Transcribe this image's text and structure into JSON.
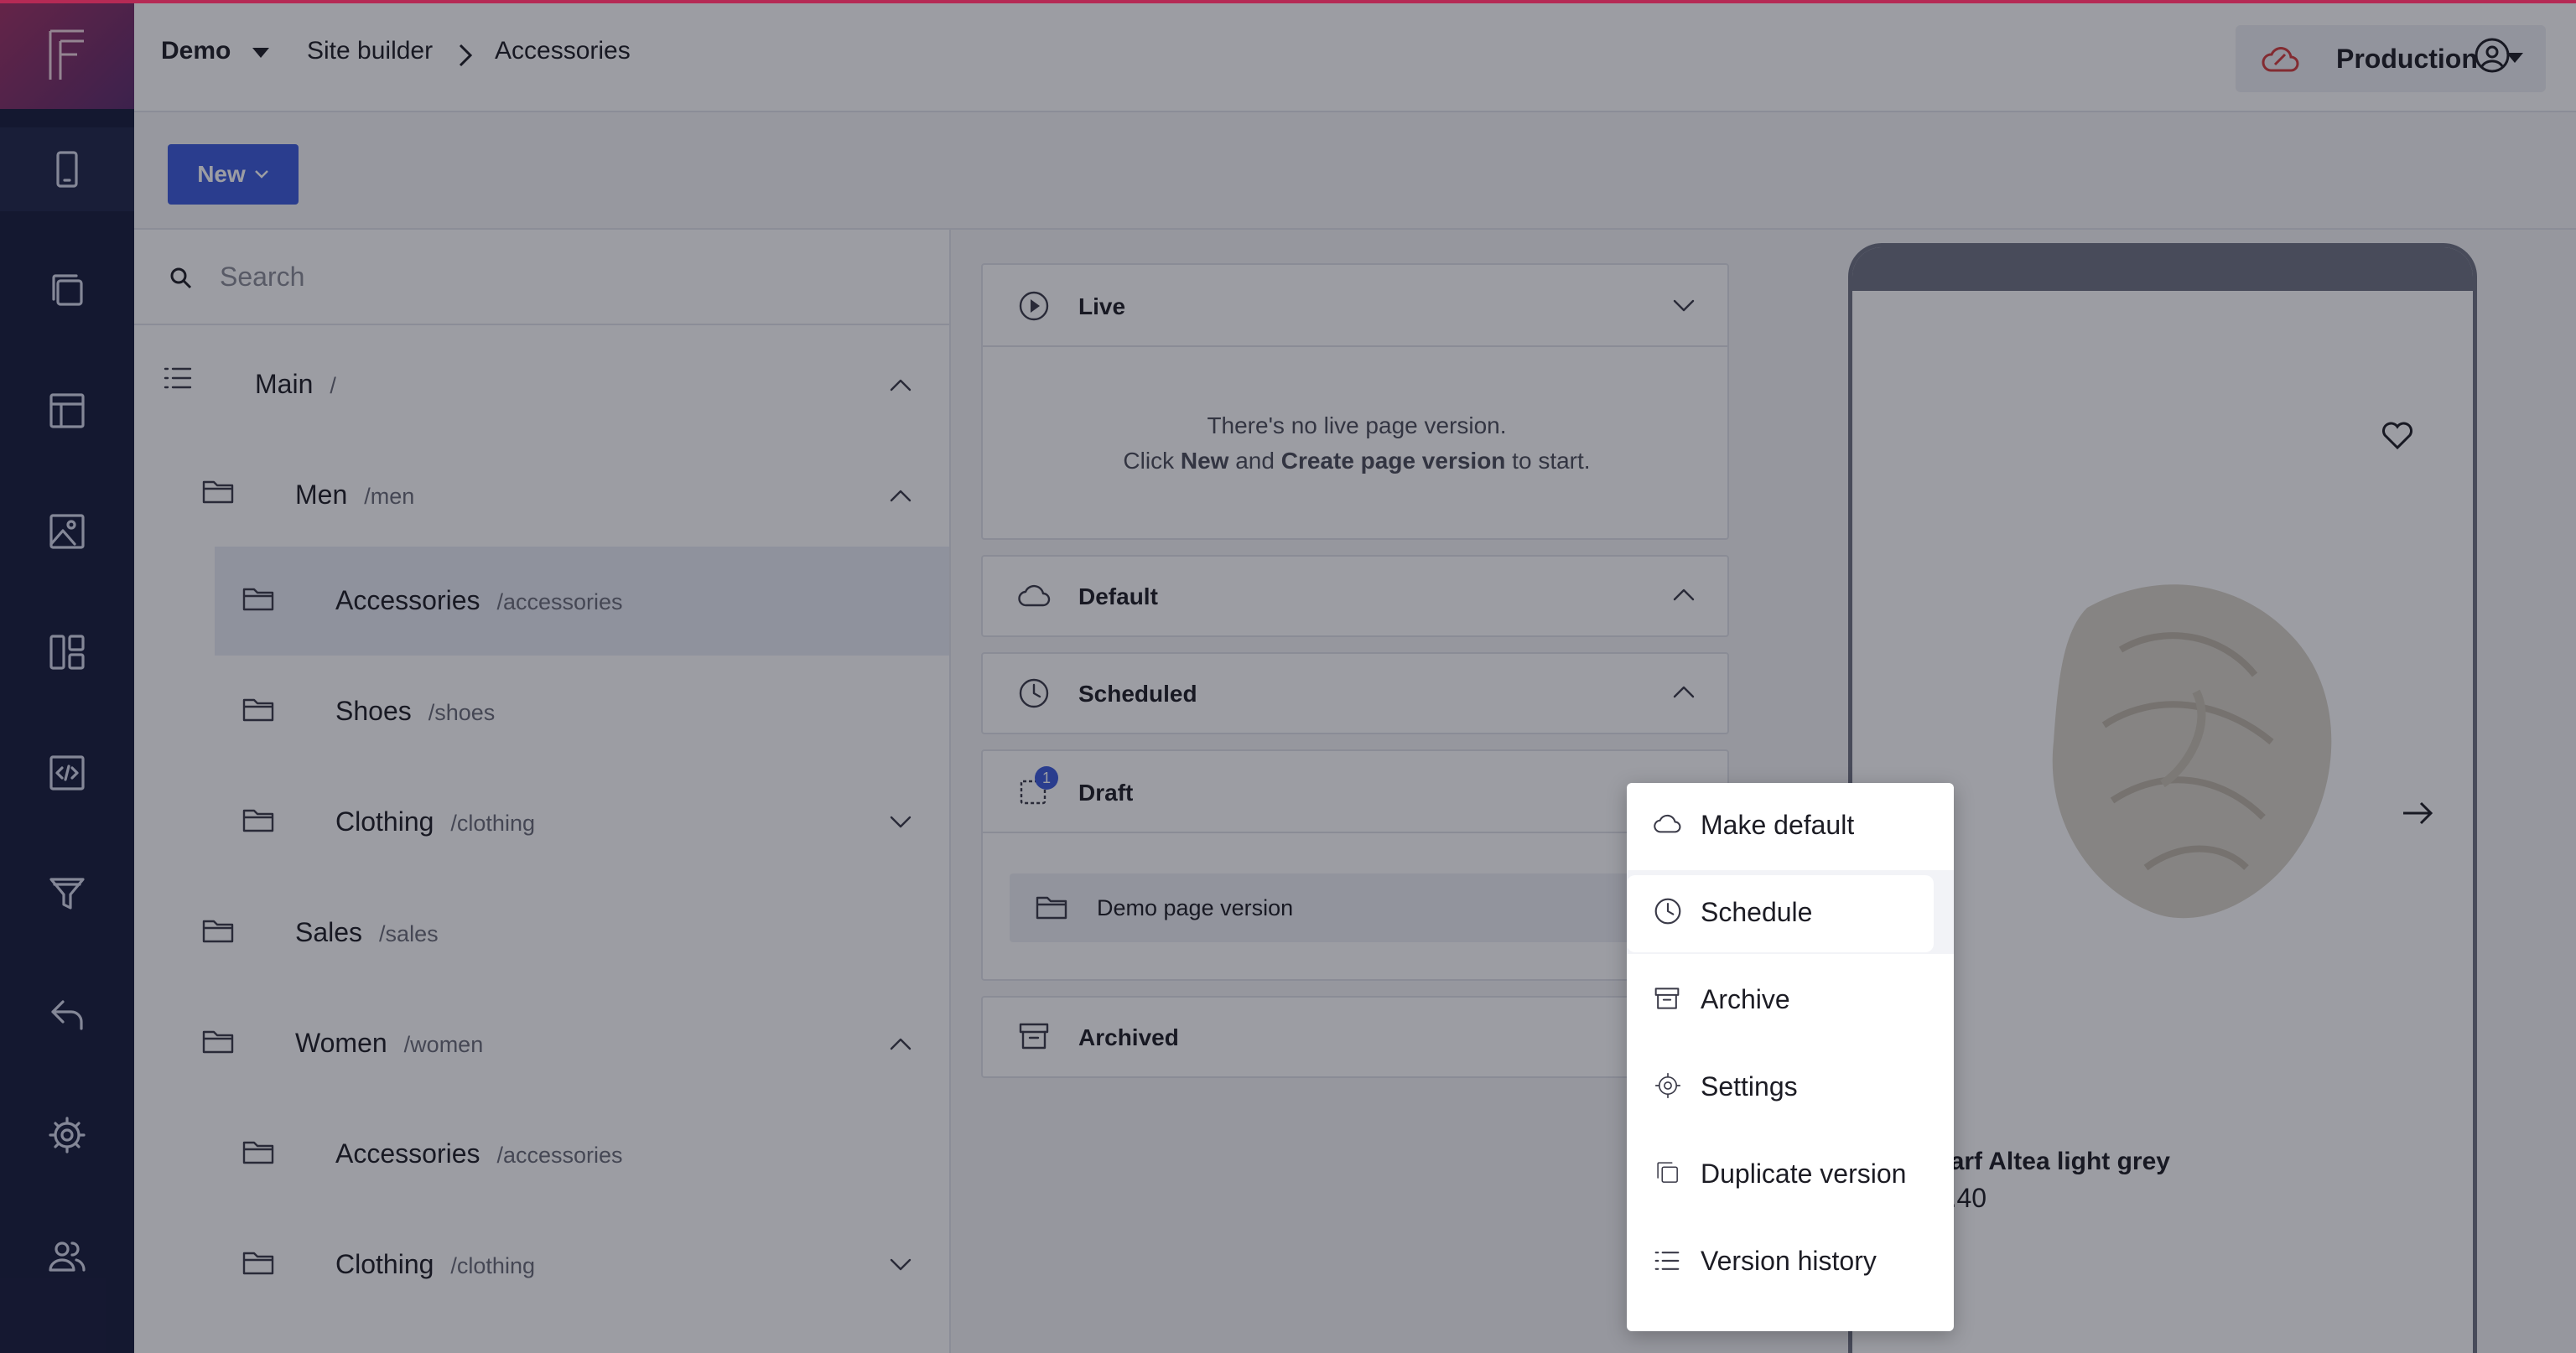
{
  "topbar": {
    "project": "Demo",
    "breadcrumb": [
      "Site builder",
      "Accessories"
    ],
    "environment": "Production"
  },
  "toolbar": {
    "new_label": "New"
  },
  "search": {
    "placeholder": "Search"
  },
  "tree": [
    {
      "name": "Main",
      "path": "/"
    },
    {
      "name": "Men",
      "path": "/men"
    },
    {
      "name": "Accessories",
      "path": "/accessories"
    },
    {
      "name": "Shoes",
      "path": "/shoes"
    },
    {
      "name": "Clothing",
      "path": "/clothing"
    },
    {
      "name": "Sales",
      "path": "/sales"
    },
    {
      "name": "Women",
      "path": "/women"
    },
    {
      "name": "Accessories",
      "path": "/accessories"
    },
    {
      "name": "Clothing",
      "path": "/clothing"
    }
  ],
  "versions": {
    "live": {
      "title": "Live",
      "empty_line1": "There's no live page version.",
      "empty_click": "Click ",
      "empty_new": "New",
      "empty_and": " and ",
      "empty_create": "Create page version",
      "empty_end": " to start."
    },
    "default_title": "Default",
    "scheduled_title": "Scheduled",
    "draft_title": "Draft",
    "draft_badge": "1",
    "draft_item": "Demo page version",
    "archived_title": "Archived"
  },
  "preview": {
    "product_name": "Scarf Altea light grey",
    "product_price": "49.40"
  },
  "menu": {
    "items": [
      "Make default",
      "Schedule",
      "Archive",
      "Settings",
      "Duplicate version",
      "Version history"
    ]
  },
  "colors": {
    "rail": "#151a3a",
    "accent": "#3b5bdb",
    "brand": "#a03063"
  }
}
